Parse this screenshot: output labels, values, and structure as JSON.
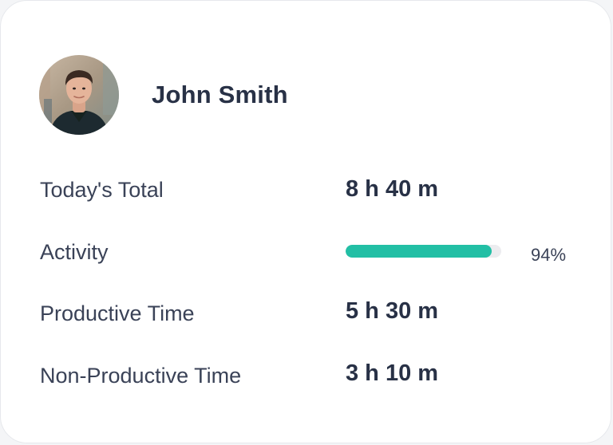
{
  "user": {
    "name": "John Smith",
    "avatar_icon": "user-photo-avatar"
  },
  "rows": {
    "todays_total": {
      "label": "Today's Total",
      "value": "8 h 40 m"
    },
    "activity": {
      "label": "Activity",
      "value": "94%",
      "progress": 0.94
    },
    "productive": {
      "label": "Productive Time",
      "value": "5 h 30 m"
    },
    "non_productive": {
      "label": "Non-Productive Time",
      "value": "3 h 10 m"
    }
  },
  "colors": {
    "accent": "#22bfa5",
    "track": "#ececef",
    "text": "#283146"
  }
}
